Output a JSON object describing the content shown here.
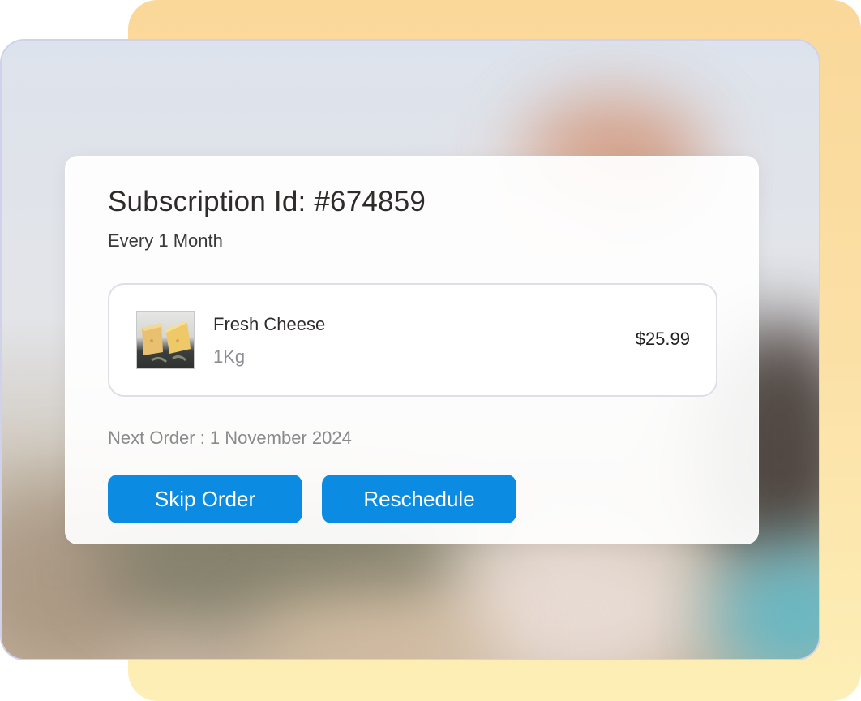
{
  "subscription": {
    "title": "Subscription Id: #674859",
    "frequency": "Every 1 Month"
  },
  "product": {
    "image_icon": "cheese-photo",
    "name": "Fresh Cheese",
    "quantity": "1Kg",
    "price": "$25.99"
  },
  "next_order": "Next Order : 1 November 2024",
  "actions": {
    "skip_label": "Skip Order",
    "reschedule_label": "Reschedule"
  },
  "colors": {
    "accent": "#0b8ce2",
    "back_panel": "#fad89a",
    "card_border": "#dcdee8"
  }
}
